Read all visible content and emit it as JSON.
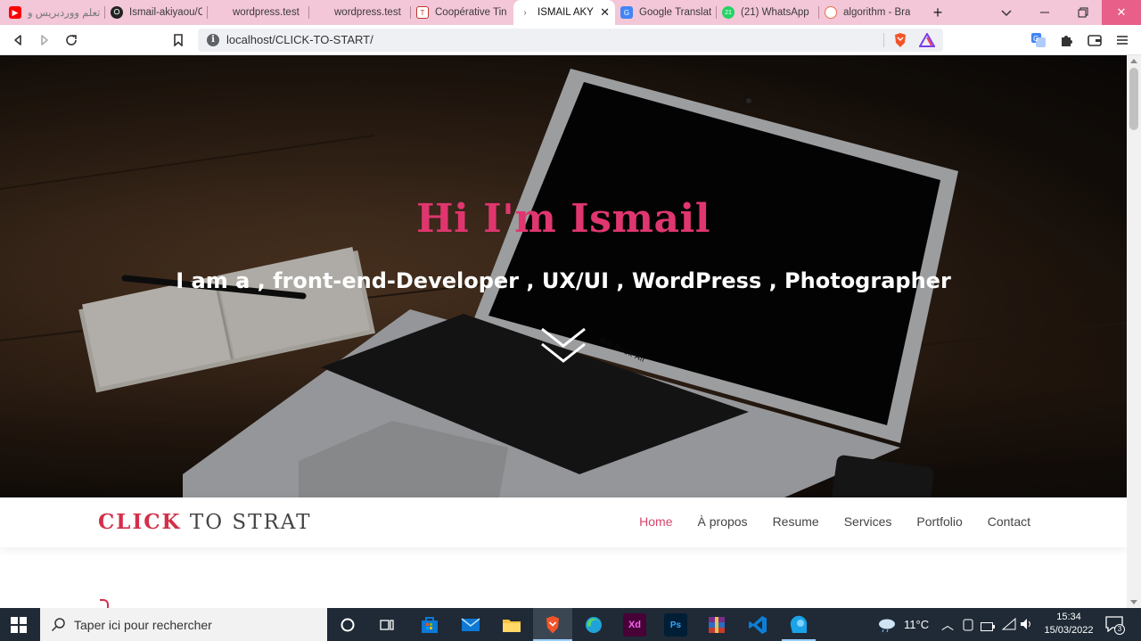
{
  "browser": {
    "tabs": [
      {
        "label": "تعلم ووردبريس و",
        "favicon": "youtube-icon",
        "active": false
      },
      {
        "label": "Ismail-akiyaou/C",
        "favicon": "github-icon",
        "active": false
      },
      {
        "label": "wordpress.test",
        "favicon": "none",
        "active": false
      },
      {
        "label": "wordpress.test",
        "favicon": "none",
        "active": false
      },
      {
        "label": "Coopérative Tin",
        "favicon": "coop-icon",
        "active": false
      },
      {
        "label": "ISMAIL AKY",
        "favicon": "page-icon",
        "active": true
      },
      {
        "label": "Google Translat",
        "favicon": "google-translate-icon",
        "active": false
      },
      {
        "label": "(21) WhatsApp",
        "favicon": "whatsapp-icon",
        "active": false
      },
      {
        "label": "algorithm - Bra",
        "favicon": "brave-search-icon",
        "active": false
      }
    ],
    "whatsapp_badge": "21",
    "url": "localhost/CLICK-TO-START/",
    "colors": {
      "tabstrip": "#f3c6d8",
      "close_button": "#e85f8a"
    }
  },
  "hero": {
    "title": "Hi I'm Ismail",
    "subtitle": "I am a , front-end-Developer , UX/UI , WordPress , Photographer",
    "laptop_label": "MacBook Air",
    "colors": {
      "title": "#e0366f",
      "subtitle": "#ffffff"
    }
  },
  "navbar": {
    "brand_part1": "CLICK",
    "brand_part2": "TO STRAT",
    "items": [
      {
        "label": "Home",
        "active": true
      },
      {
        "label": "À propos",
        "active": false
      },
      {
        "label": "Resume",
        "active": false
      },
      {
        "label": "Services",
        "active": false
      },
      {
        "label": "Portfolio",
        "active": false
      },
      {
        "label": "Contact",
        "active": false
      }
    ],
    "colors": {
      "brand_accent": "#d32f4a",
      "active_link": "#d6456a"
    }
  },
  "taskbar": {
    "search_placeholder": "Taper ici pour rechercher",
    "apps": [
      "cortana-icon",
      "task-view-icon",
      "store-icon",
      "mail-icon",
      "file-explorer-icon",
      "brave-icon",
      "edge-icon",
      "adobe-xd-icon",
      "photoshop-icon",
      "winrar-icon",
      "vscode-icon",
      "app-icon"
    ],
    "xd_label": "Xd",
    "ps_label": "Ps",
    "weather": "11°C",
    "time": "15:34",
    "date": "15/03/2022",
    "notification_count": "3"
  }
}
